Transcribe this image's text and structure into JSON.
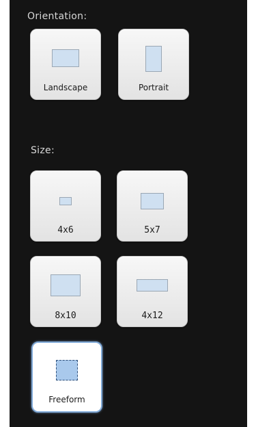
{
  "orientation": {
    "label": "Orientation:",
    "options": [
      {
        "label": "Landscape",
        "icon": "landscape-icon"
      },
      {
        "label": "Portrait",
        "icon": "portrait-icon"
      }
    ]
  },
  "size": {
    "label": "Size:",
    "options": [
      {
        "label": "4x6",
        "icon": "size-4x6-icon"
      },
      {
        "label": "5x7",
        "icon": "size-5x7-icon"
      },
      {
        "label": "8x10",
        "icon": "size-8x10-icon"
      },
      {
        "label": "4x12",
        "icon": "size-4x12-icon"
      },
      {
        "label": "Freeform",
        "icon": "freeform-icon",
        "selected": true
      }
    ]
  },
  "colors": {
    "panel_background": "#141414",
    "label_text": "#d8d8d8",
    "shape_fill": "#cfe0f1",
    "selected_border": "#7fa8d6"
  }
}
